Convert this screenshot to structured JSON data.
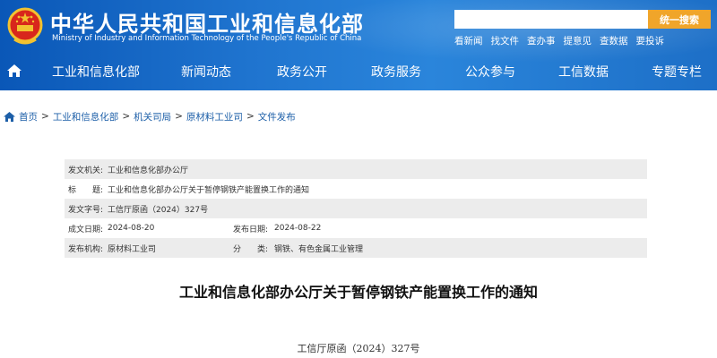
{
  "header": {
    "title": "中华人民共和国工业和信息化部",
    "subtitle": "Ministry of Industry and Information Technology of the People's Republic of China",
    "search_placeholder": "",
    "search_button": "统一搜索",
    "quick_links": [
      "看新闻",
      "找文件",
      "查办事",
      "提意见",
      "查数据",
      "要投诉"
    ]
  },
  "nav": {
    "items": [
      "工业和信息化部",
      "新闻动态",
      "政务公开",
      "政务服务",
      "公众参与",
      "工信数据",
      "专题专栏"
    ]
  },
  "breadcrumb": {
    "items": [
      "首页",
      "工业和信息化部",
      "机关司局",
      "原材料工业司",
      "文件发布"
    ]
  },
  "meta": {
    "issuer_label": "发文机关:",
    "issuer_value": "工业和信息化部办公厅",
    "title_label": "标　　题:",
    "title_value": "工业和信息化部办公厅关于暂停钢铁产能置换工作的通知",
    "docno_label": "发文字号:",
    "docno_value": "工信厅原函（2024）327号",
    "date_label": "成文日期:",
    "date_value": "2024-08-20",
    "pubdate_label": "发布日期:",
    "pubdate_value": "2024-08-22",
    "org_label": "发布机构:",
    "org_value": "原材料工业司",
    "category_label": "分　　类:",
    "category_value": "钢铁、有色金属工业管理"
  },
  "document": {
    "title": "工业和信息化部办公厅关于暂停钢铁产能置换工作的通知",
    "number": "工信厅原函（2024）327号"
  },
  "colors": {
    "header_blue": "#1f74cf",
    "search_orange": "#f0a52a",
    "link_blue": "#1d5fa8"
  }
}
